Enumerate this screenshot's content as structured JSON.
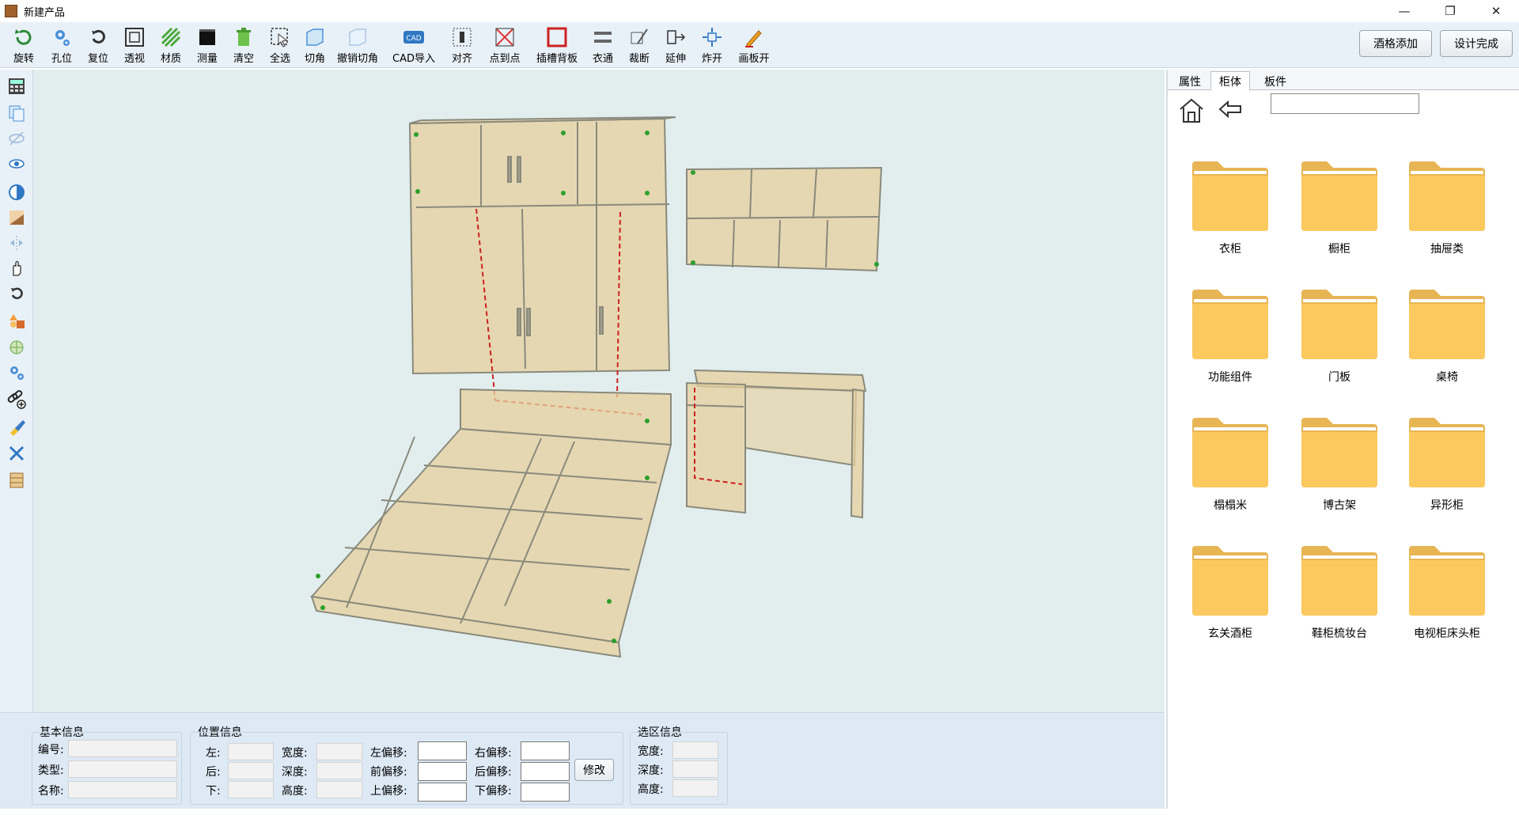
{
  "window": {
    "title": "新建产品"
  },
  "toolbar": {
    "tools": [
      {
        "label": "旋转",
        "icon": "rotate-icon"
      },
      {
        "label": "孔位",
        "icon": "gear-icon"
      },
      {
        "label": "复位",
        "icon": "reset-icon"
      },
      {
        "label": "透视",
        "icon": "perspective-icon"
      },
      {
        "label": "材质",
        "icon": "material-icon"
      },
      {
        "label": "测量",
        "icon": "measure-icon"
      },
      {
        "label": "清空",
        "icon": "trash-icon"
      },
      {
        "label": "全选",
        "icon": "select-all-icon"
      },
      {
        "label": "切角",
        "icon": "chamfer-icon"
      },
      {
        "label": "撤销切角",
        "icon": "undo-chamfer-icon"
      },
      {
        "label": "CAD导入",
        "icon": "cad-import-icon"
      },
      {
        "label": "对齐",
        "icon": "align-icon"
      },
      {
        "label": "点到点",
        "icon": "point-to-point-icon"
      },
      {
        "label": "插槽背板",
        "icon": "slot-backboard-icon"
      },
      {
        "label": "衣通",
        "icon": "rail-icon"
      },
      {
        "label": "裁断",
        "icon": "cut-icon"
      },
      {
        "label": "延伸",
        "icon": "extend-icon"
      },
      {
        "label": "炸开",
        "icon": "explode-icon"
      },
      {
        "label": "画板开",
        "icon": "pencil-icon"
      }
    ],
    "right_buttons": [
      "酒格添加",
      "设计完成"
    ]
  },
  "left_tools": [
    "calculator-icon",
    "copy-icon",
    "hide-icon",
    "eye-icon",
    "contrast-icon",
    "texture-icon",
    "mirror-icon",
    "hand-icon",
    "reset-view-icon",
    "shapes-icon",
    "globe-icon",
    "settings-icon",
    "link-add-icon",
    "brush-icon",
    "tools-icon",
    "panel-icon"
  ],
  "info": {
    "basic": {
      "title": "基本信息",
      "labels": [
        "编号:",
        "类型:",
        "名称:"
      ]
    },
    "position": {
      "title": "位置信息",
      "col1": [
        "左:",
        "后:",
        "下:"
      ],
      "col2": [
        "宽度:",
        "深度:",
        "高度:"
      ],
      "col3": [
        "左偏移:",
        "前偏移:",
        "上偏移:"
      ],
      "col4": [
        "右偏移:",
        "后偏移:",
        "下偏移:"
      ],
      "modify_label": "修改"
    },
    "selection": {
      "title": "选区信息",
      "labels": [
        "宽度:",
        "深度:",
        "高度:"
      ]
    }
  },
  "right_panel": {
    "tabs": [
      "属性",
      "柜体",
      "板件"
    ],
    "active_tab": "柜体",
    "folders": [
      "衣柜",
      "橱柜",
      "抽屉类",
      "功能组件",
      "门板",
      "桌椅",
      "榻榻米",
      "博古架",
      "异形柜",
      "玄关酒柜",
      "鞋柜梳妆台",
      "电视柜床头柜"
    ]
  },
  "colors": {
    "toolbar_bg": "#e9f1f8",
    "viewport_bg": "#e2eeee",
    "folder": "#fcc95f",
    "wood": "#e6cf9c"
  }
}
